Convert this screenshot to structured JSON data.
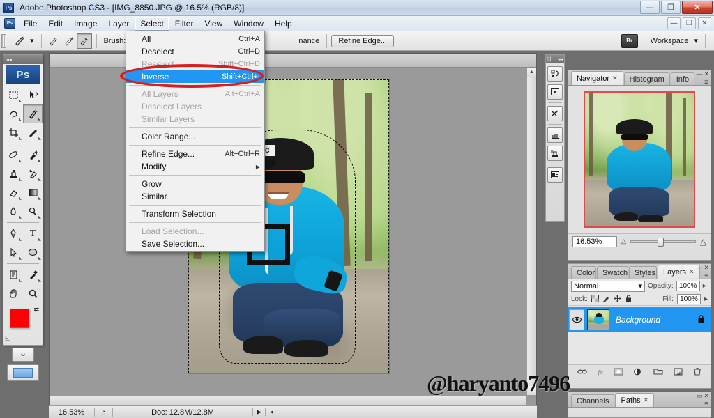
{
  "window": {
    "title": "Adobe Photoshop CS3 - [IMG_8850.JPG @ 16.5% (RGB/8)]",
    "app_icon": "Ps",
    "minimize": "—",
    "restore": "❐",
    "close": "✕"
  },
  "menubar": {
    "doc_icon": "Ps",
    "items": [
      {
        "label": "File"
      },
      {
        "label": "Edit"
      },
      {
        "label": "Image"
      },
      {
        "label": "Layer"
      },
      {
        "label": "Select"
      },
      {
        "label": "Filter"
      },
      {
        "label": "View"
      },
      {
        "label": "Window"
      },
      {
        "label": "Help"
      }
    ],
    "doc_minimize": "—",
    "doc_restore": "❐",
    "doc_close": "✕"
  },
  "options_bar": {
    "tool_icon": "quick-selection-tool",
    "preset_arrow": "▾",
    "mode_new": "✧",
    "mode_add": "✧",
    "mode_subtract": "✧",
    "brush_label": "Brush:",
    "auto_enhance_partial": "nance",
    "refine_edge_button": "Refine Edge...",
    "bridge_icon": "Br",
    "workspace_label": "Workspace",
    "workspace_arrow": "▾"
  },
  "toolbox": {
    "logo": "Ps",
    "grip": "◂◂",
    "tools": [
      {
        "name": "marquee-tool",
        "glyph": "⬚"
      },
      {
        "name": "move-tool",
        "glyph": "➤"
      },
      {
        "name": "lasso-tool",
        "glyph": "⌇"
      },
      {
        "name": "quick-selection-tool",
        "glyph": "✦"
      },
      {
        "name": "crop-tool",
        "glyph": "⌗"
      },
      {
        "name": "slice-tool",
        "glyph": "✒"
      },
      {
        "name": "healing-brush-tool",
        "glyph": "✐"
      },
      {
        "name": "brush-tool",
        "glyph": "✎"
      },
      {
        "name": "clone-stamp-tool",
        "glyph": "⚓"
      },
      {
        "name": "history-brush-tool",
        "glyph": "❀"
      },
      {
        "name": "eraser-tool",
        "glyph": "▱"
      },
      {
        "name": "gradient-tool",
        "glyph": "▤"
      },
      {
        "name": "blur-tool",
        "glyph": "◌"
      },
      {
        "name": "dodge-tool",
        "glyph": "◖"
      },
      {
        "name": "pen-tool",
        "glyph": "✒"
      },
      {
        "name": "type-tool",
        "glyph": "T"
      },
      {
        "name": "path-selection-tool",
        "glyph": "➤"
      },
      {
        "name": "ellipse-shape-tool",
        "glyph": "●"
      },
      {
        "name": "notes-tool",
        "glyph": "▤"
      },
      {
        "name": "eyedropper-tool",
        "glyph": "✒"
      },
      {
        "name": "hand-tool",
        "glyph": "✋"
      },
      {
        "name": "zoom-tool",
        "glyph": "⌕"
      }
    ],
    "foreground_color": "#ff0000",
    "background_color": "#93a396",
    "swap_icon": "⇄",
    "default_icon": "◰",
    "quick_mask_icon": "○",
    "screen_mode_icon": "▣"
  },
  "select_menu": {
    "groups": [
      [
        {
          "label": "All",
          "accel": "Ctrl+A",
          "state": "enabled"
        },
        {
          "label": "Deselect",
          "accel": "Ctrl+D",
          "state": "enabled"
        },
        {
          "label": "Reselect",
          "accel": "Shift+Ctrl+D",
          "state": "disabled"
        },
        {
          "label": "Inverse",
          "accel": "Shift+Ctrl+I",
          "state": "highlighted"
        }
      ],
      [
        {
          "label": "All Layers",
          "accel": "Alt+Ctrl+A",
          "state": "disabled"
        },
        {
          "label": "Deselect Layers",
          "accel": "",
          "state": "disabled"
        },
        {
          "label": "Similar Layers",
          "accel": "",
          "state": "disabled"
        }
      ],
      [
        {
          "label": "Color Range...",
          "accel": "",
          "state": "enabled"
        }
      ],
      [
        {
          "label": "Refine Edge...",
          "accel": "Alt+Ctrl+R",
          "state": "enabled"
        },
        {
          "label": "Modify",
          "accel": "▶",
          "state": "submenu"
        }
      ],
      [
        {
          "label": "Grow",
          "accel": "",
          "state": "enabled"
        },
        {
          "label": "Similar",
          "accel": "",
          "state": "enabled"
        }
      ],
      [
        {
          "label": "Transform Selection",
          "accel": "",
          "state": "enabled"
        }
      ],
      [
        {
          "label": "Load Selection...",
          "accel": "",
          "state": "disabled"
        },
        {
          "label": "Save Selection...",
          "accel": "",
          "state": "enabled"
        }
      ]
    ],
    "annotation_color": "#e01b1b"
  },
  "icon_dock": {
    "grip": "◂◂",
    "buttons": [
      {
        "name": "history-panel-icon",
        "glyph": "↺"
      },
      {
        "name": "actions-panel-icon",
        "glyph": "▶"
      },
      {
        "name": "tool-presets-panel-icon",
        "glyph": "⚒"
      },
      {
        "name": "brushes-panel-icon",
        "glyph": "✒"
      },
      {
        "name": "clone-source-panel-icon",
        "glyph": "⚙"
      },
      {
        "name": "character-panel-icon",
        "glyph": "☰"
      }
    ]
  },
  "navigator_panel": {
    "tabs": [
      {
        "label": "Navigator",
        "active": true,
        "closable": true
      },
      {
        "label": "Histogram",
        "active": false,
        "closable": false
      },
      {
        "label": "Info",
        "active": false,
        "closable": false
      }
    ],
    "zoom_value": "16.53%",
    "zoom_out_icon": "△",
    "zoom_in_icon": "△",
    "menu_icon": "≡",
    "minimize": "—",
    "close": "✕",
    "view_box_color": "#e04a4a"
  },
  "layers_panel": {
    "tabs": [
      {
        "label": "Color",
        "active": false
      },
      {
        "label": "Swatch",
        "active": false
      },
      {
        "label": "Styles",
        "active": false
      },
      {
        "label": "Layers",
        "active": true,
        "closable": true
      }
    ],
    "blend_mode": "Normal",
    "blend_arrow": "▾",
    "opacity_label": "Opacity:",
    "opacity_value": "100%",
    "opacity_arrow": "▸",
    "lock_label": "Lock:",
    "lock_icons": [
      "▦",
      "✐",
      "✤",
      "□"
    ],
    "fill_label": "Fill:",
    "fill_value": "100%",
    "fill_arrow": "▸",
    "layers": [
      {
        "name": "Background",
        "visible": true,
        "locked": true,
        "selected": true
      }
    ],
    "bottom_buttons": [
      {
        "name": "link-layers-button",
        "glyph": "⚭"
      },
      {
        "name": "layer-style-button",
        "glyph": "fx"
      },
      {
        "name": "layer-mask-button",
        "glyph": "▢"
      },
      {
        "name": "adjustment-layer-button",
        "glyph": "◑"
      },
      {
        "name": "new-group-button",
        "glyph": "▭"
      },
      {
        "name": "new-layer-button",
        "glyph": "▣"
      },
      {
        "name": "delete-layer-button",
        "glyph": "Ὕ1"
      }
    ],
    "menu_icon": "≡",
    "minimize": "—",
    "close": "✕"
  },
  "channels_panel": {
    "tabs": [
      {
        "label": "Channels",
        "active": false
      },
      {
        "label": "Paths",
        "active": true,
        "closable": true
      }
    ],
    "menu_icon": "≡",
    "minimize": "▭",
    "close": "✕"
  },
  "status_bar": {
    "zoom": "16.53%",
    "clock_icon": "◔",
    "doc_info": "Doc: 12.8M/12.8M",
    "arrow": "▶",
    "scroll_arrow": "◂"
  },
  "watermark": {
    "text": "@haryanto7496"
  },
  "document": {
    "filename": "IMG_8850.JPG",
    "zoom": "16.5%",
    "color_mode": "RGB/8",
    "cap_logo": "DC"
  }
}
